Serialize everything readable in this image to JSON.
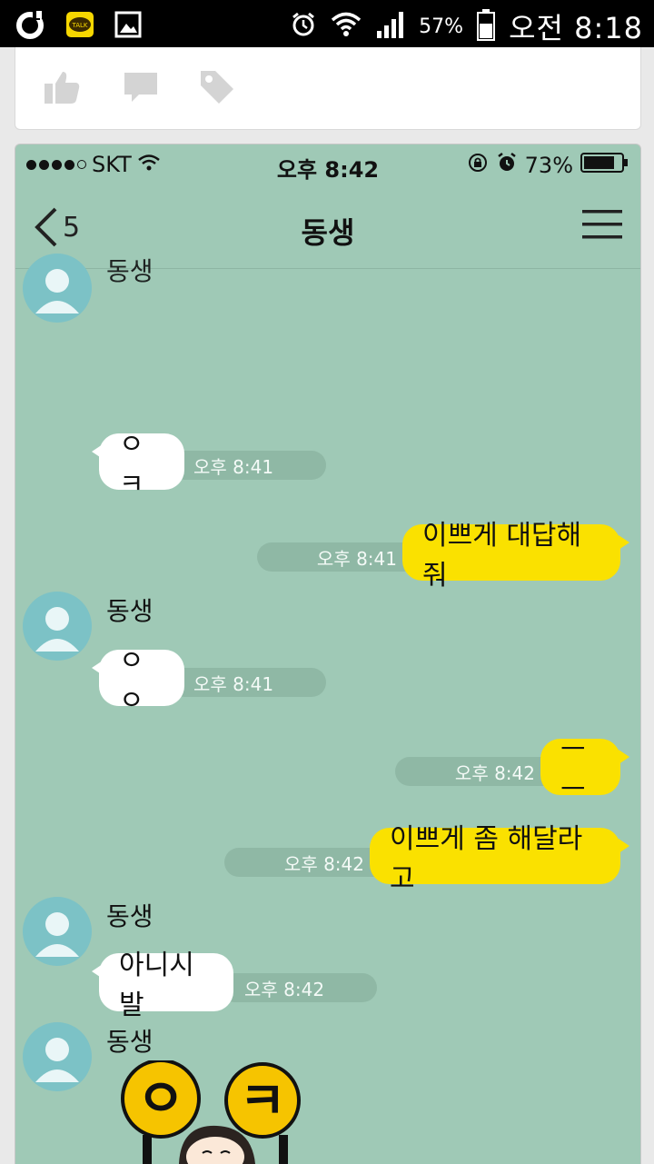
{
  "android_status": {
    "clock": "오전 8:18",
    "battery_percent": "57%",
    "icons": [
      "olleh-icon",
      "kakaotalk-icon",
      "gallery-icon",
      "alarm-icon",
      "wifi-icon",
      "signal-icon",
      "battery-icon"
    ],
    "kakao_icon_text": "TALK"
  },
  "post_actions": [
    {
      "icon": "thumbs-up-icon"
    },
    {
      "icon": "comment-icon"
    },
    {
      "icon": "tag-icon"
    }
  ],
  "screenshot": {
    "ios_status": {
      "carrier": "SKT",
      "time": "오후 8:42",
      "battery_percent": "73%"
    },
    "nav": {
      "back_count": "5",
      "title": "동생"
    },
    "messages": [
      {
        "side": "in",
        "show_sender": false,
        "text": "ㅇㅋ",
        "time": "오후 8:41"
      },
      {
        "side": "out",
        "text": "이쁘게 대답해줘",
        "time": "오후 8:41"
      },
      {
        "side": "in",
        "sender": "동생",
        "text": "ㅇㅇ",
        "time": "오후 8:41"
      },
      {
        "side": "out",
        "text": "ㅡㅡ",
        "time": "오후 8:42"
      },
      {
        "side": "out",
        "text": "이쁘게 좀 해달라고",
        "time": "오후 8:42"
      },
      {
        "side": "in",
        "sender": "동생",
        "text": "아니시발",
        "time": "오후 8:42"
      },
      {
        "side": "in",
        "sender": "동생",
        "sticker": "ok-sticker",
        "sticker_letters": [
          "ㅇ",
          "ㅋ"
        ]
      }
    ]
  },
  "colors": {
    "chat_bg": "#9fc9b6",
    "my_bubble": "#fae100",
    "their_bubble": "#ffffff",
    "avatar": "#7cc2c6"
  }
}
